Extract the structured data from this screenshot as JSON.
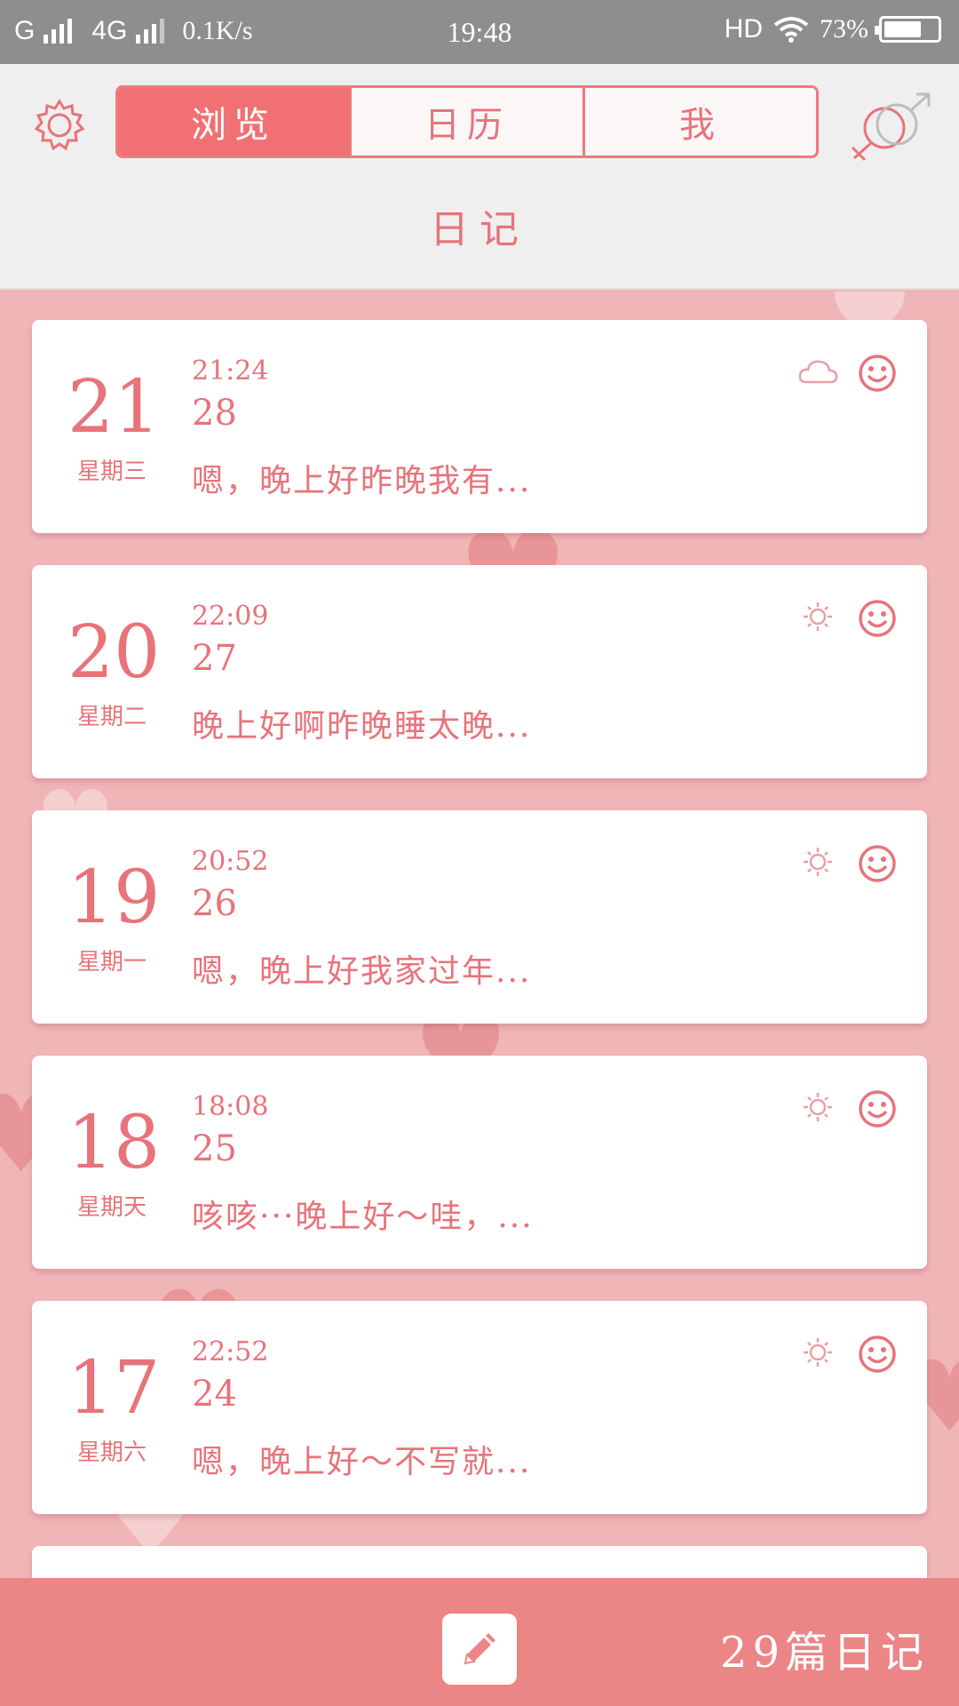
{
  "status_bar": {
    "carrier1": "G",
    "carrier2": "4G",
    "speed": "0.1K/s",
    "time": "19:48",
    "hd": "HD",
    "battery": "73%",
    "battery_level": 0.73
  },
  "header": {
    "tabs": [
      {
        "label": "浏览",
        "active": true
      },
      {
        "label": "日历",
        "active": false
      },
      {
        "label": "我",
        "active": false
      }
    ],
    "title": "日记"
  },
  "entries": [
    {
      "day": "21",
      "weekday": "星期三",
      "time": "21:24",
      "number": "28",
      "excerpt": "嗯，晚上好昨晚我有...",
      "weather_icon": "cloud-icon",
      "mood_icon": "smile-icon"
    },
    {
      "day": "20",
      "weekday": "星期二",
      "time": "22:09",
      "number": "27",
      "excerpt": "晚上好啊昨晚睡太晚...",
      "weather_icon": "sun-icon",
      "mood_icon": "smile-icon"
    },
    {
      "day": "19",
      "weekday": "星期一",
      "time": "20:52",
      "number": "26",
      "excerpt": "嗯，晚上好我家过年...",
      "weather_icon": "sun-icon",
      "mood_icon": "smile-icon"
    },
    {
      "day": "18",
      "weekday": "星期天",
      "time": "18:08",
      "number": "25",
      "excerpt": "咳咳···晚上好～哇，...",
      "weather_icon": "sun-icon",
      "mood_icon": "smile-icon"
    },
    {
      "day": "17",
      "weekday": "星期六",
      "time": "22:52",
      "number": "24",
      "excerpt": "嗯，晚上好～不写就...",
      "weather_icon": "sun-icon",
      "mood_icon": "smile-icon"
    }
  ],
  "bottom_bar": {
    "count_label": "29篇日记"
  },
  "colors": {
    "accent": "#e8737a",
    "tab_active": "#f07074",
    "background": "#f0b5b7",
    "bottom_bar": "#ec8586"
  }
}
